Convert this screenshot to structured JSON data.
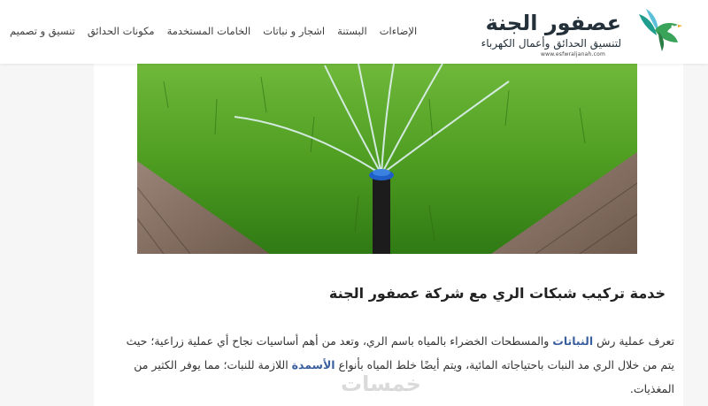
{
  "header": {
    "logo": {
      "name": "عصفور الجنة",
      "tagline": "لتنسيق الحدائق وأعمال الكهرباء",
      "url": "www.esfwraljanah.com"
    },
    "nav": [
      {
        "label": "تنسيق و تصميم"
      },
      {
        "label": "مكونات الحدائق"
      },
      {
        "label": "الخامات المستخدمة"
      },
      {
        "label": "اشجار و نباتات"
      },
      {
        "label": "البستنة"
      },
      {
        "label": "الإضاءات"
      }
    ]
  },
  "article": {
    "title": "خدمة تركيب شبكات الري مع شركة عصفور الجنة",
    "body": {
      "part1": "تعرف عملية رش ",
      "link1": "النباتات",
      "part2": " والمسطحات الخضراء بالمياه باسم الري، وتعد من أهم أساسيات نجاح أي عملية زراعية؛ حيث يتم من خلال الري مد النبات باحتياجاته المائية، ويتم أيضًا خلط المياه بأنواع ",
      "link2": "الأسمدة",
      "part3": " اللازمة للنبات؛ مما يوفر الكثير من المغذيات."
    }
  },
  "watermark": "خمسات",
  "colors": {
    "link": "#3a5f9e",
    "logo_green": "#2e8b57",
    "logo_teal": "#1aa89a"
  }
}
